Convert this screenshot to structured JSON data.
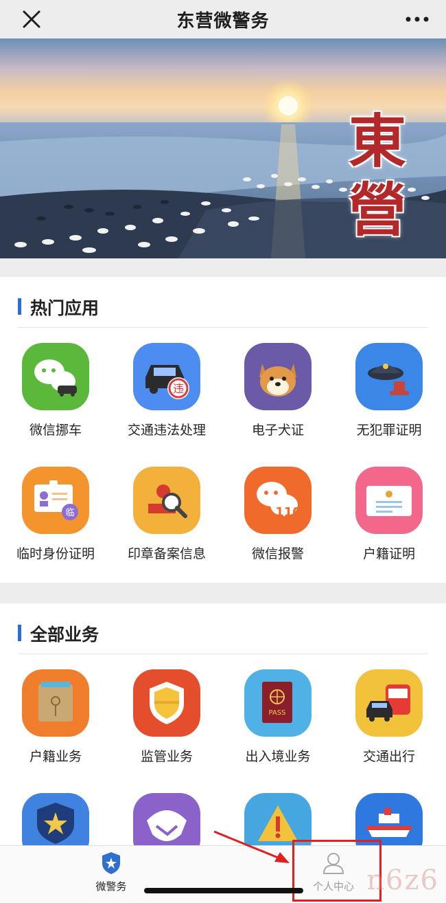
{
  "titlebar": {
    "title": "东营微警务"
  },
  "banner": {
    "text": "東營"
  },
  "hot": {
    "title": "热门应用",
    "items": [
      {
        "label": "微信挪车",
        "icon": "wechat-car-icon"
      },
      {
        "label": "交通违法处理",
        "icon": "traffic-violation-icon"
      },
      {
        "label": "电子犬证",
        "icon": "dog-license-icon"
      },
      {
        "label": "无犯罪证明",
        "icon": "police-stamp-icon"
      },
      {
        "label": "临时身份证明",
        "icon": "temp-id-icon"
      },
      {
        "label": "印章备案信息",
        "icon": "seal-record-icon"
      },
      {
        "label": "微信报警",
        "icon": "wechat-110-icon"
      },
      {
        "label": "户籍证明",
        "icon": "household-certificate-icon"
      }
    ],
    "badge_wei": "违",
    "badge_lin": "临",
    "badge_110": "110"
  },
  "all": {
    "title": "全部业务",
    "items": [
      {
        "label": "户籍业务",
        "icon": "household-folder-icon"
      },
      {
        "label": "监管业务",
        "icon": "supervision-shield-icon"
      },
      {
        "label": "出入境业务",
        "icon": "passport-icon"
      },
      {
        "label": "交通出行",
        "icon": "traffic-travel-icon"
      },
      {
        "label": "",
        "icon": "police-badge-icon"
      },
      {
        "label": "",
        "icon": "handshake-icon"
      },
      {
        "label": "",
        "icon": "warning-icon"
      },
      {
        "label": "",
        "icon": "ship-icon"
      }
    ],
    "passport_text": "PASS"
  },
  "tabbar": {
    "home": "微警务",
    "me": "个人中心"
  },
  "watermark": "n6z6",
  "colors": {
    "accent": "#2a6fd6",
    "annotation": "#e0201f",
    "banner_text": "#b3292a"
  }
}
